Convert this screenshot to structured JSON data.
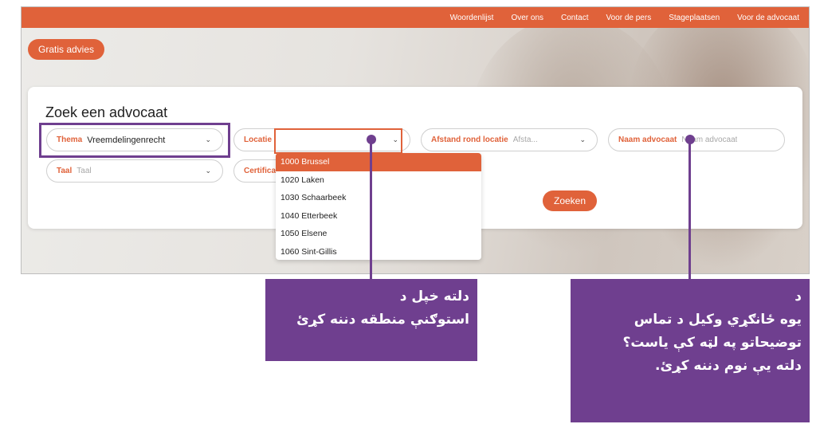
{
  "nav": {
    "items": [
      "Woordenlijst",
      "Over ons",
      "Contact",
      "Voor de pers",
      "Stageplaatsen",
      "Voor de advocaat"
    ]
  },
  "gratis_button": "Gratis advies",
  "search": {
    "title": "Zoek een advocaat",
    "thema": {
      "label": "Thema",
      "value": "Vreemdelingenrecht"
    },
    "locatie": {
      "label": "Locatie",
      "value": ""
    },
    "afstand": {
      "label": "Afstand rond locatie",
      "placeholder": "Afsta..."
    },
    "naam": {
      "label": "Naam advocaat",
      "placeholder": "Naam advocaat"
    },
    "taal": {
      "label": "Taal",
      "placeholder": "Taal"
    },
    "certificaat": {
      "label": "Certifica"
    },
    "submit": "Zoeken"
  },
  "dropdown": {
    "options": [
      "1000 Brussel",
      "1020 Laken",
      "1030 Schaarbeek",
      "1040 Etterbeek",
      "1050 Elsene",
      "1060 Sint-Gillis"
    ],
    "selected_index": 0
  },
  "callouts": {
    "left": [
      "دلته خپل د",
      "استوګنې منطقه دننه کړئ"
    ],
    "right": [
      "د",
      "یوه ځانګړي وکیل د تماس",
      "توضیحاتو په لټه کې یاست؟",
      "دلته یې نوم دننه کړئ."
    ]
  },
  "colors": {
    "accent": "#e0623a",
    "annotation": "#6f3f8f"
  },
  "icons": {
    "chevron": "chevron-down-icon"
  }
}
